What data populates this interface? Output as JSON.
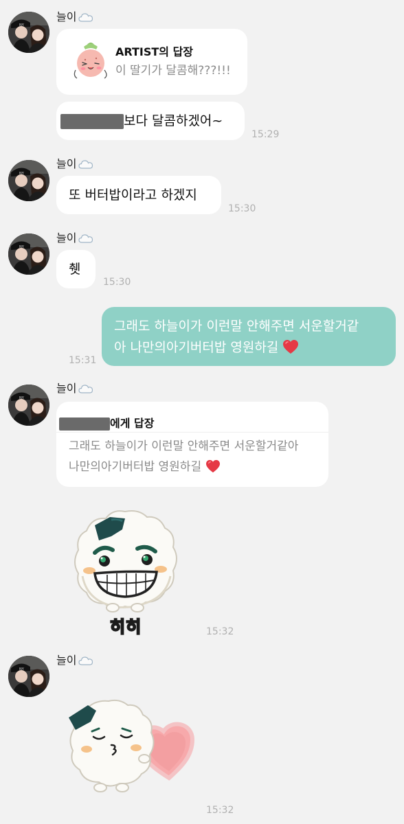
{
  "messages": {
    "m1": {
      "sender": "늘이",
      "reply_title_bold": "ARTIST",
      "reply_title_rest": "의 답장",
      "reply_quote": "이 딸기가 달콤해???!!!",
      "bubble_text_after_redaction": "보다 달콤하겠어~",
      "time": "15:29"
    },
    "m2": {
      "sender": "늘이",
      "text": "또 버터밥이라고 하겠지",
      "time": "15:30"
    },
    "m3": {
      "sender": "늘이",
      "text": "췟",
      "time": "15:30"
    },
    "m4": {
      "line1": "그래도 하늘이가 이런말 안해주면 서운할거같",
      "line2": "아 나만의아기버터밥 영원하길",
      "time": "15:31"
    },
    "m5": {
      "sender": "늘이",
      "reply_title_rest": "에게 답장",
      "quote_line1": "그래도 하늘이가 이런말 안해주면 서운할거같아",
      "quote_line2": "나만의아기버터밥 영원하길"
    },
    "m6": {
      "sticker": "rice-ball-grin-sticker",
      "sticker_caption": "히히",
      "time": "15:32"
    },
    "m7": {
      "sender": "늘이",
      "sticker": "rice-ball-kiss-heart-sticker",
      "time": "15:32"
    }
  },
  "colors": {
    "background": "#f2f2f2",
    "my_bubble": "#8fd1c6",
    "their_bubble": "#ffffff",
    "time_text": "#b0b0b0",
    "heart": "#e53945"
  }
}
